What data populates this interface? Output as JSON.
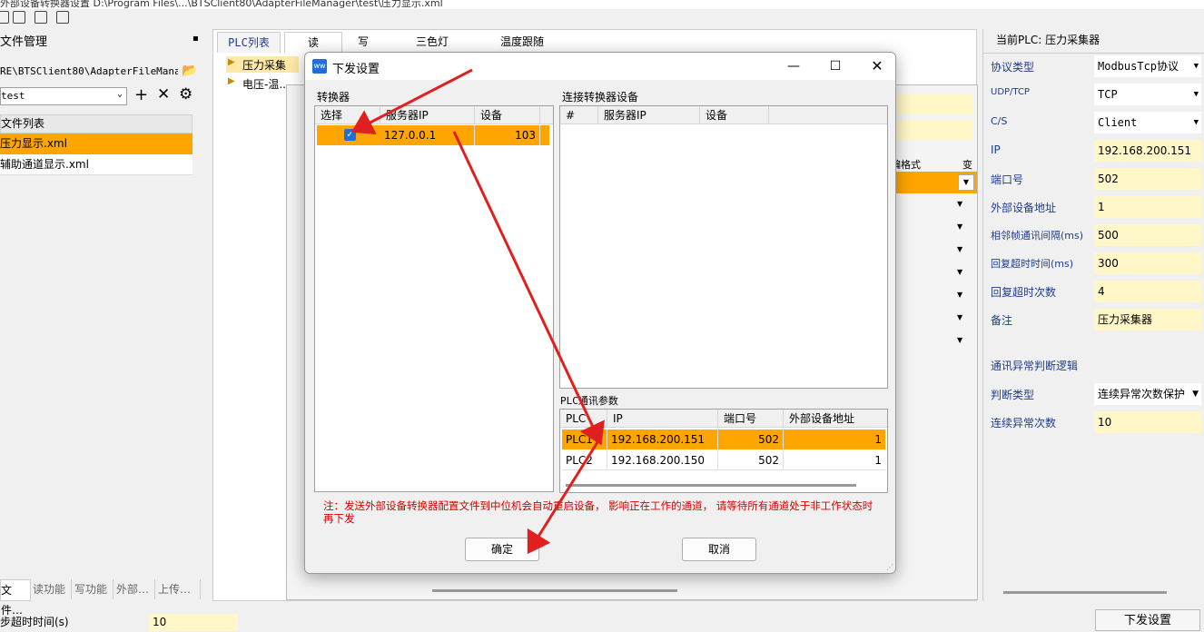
{
  "window": {
    "title_partial": "外部设备转换器设置 D:\\Program Files\\...\\BTSClient80\\AdapterFileManager\\test\\压力显示.xml"
  },
  "left": {
    "header": "文件管理",
    "path": "RE\\BTSClient80\\AdapterFileManager",
    "selected_folder": "test",
    "list_header": "文件列表",
    "files": [
      "压力显示.xml",
      "辅助通道显示.xml"
    ],
    "bottom_tabs": [
      "文件…",
      "读功能",
      "写功能",
      "外部…",
      "上传…"
    ]
  },
  "center": {
    "tabs": [
      "PLC列表",
      "读",
      "写",
      "三色灯",
      "温度跟随"
    ],
    "tree": [
      "压力采集",
      "电压-温..."
    ],
    "col_partial_1": "编格式",
    "col_partial_2": "变"
  },
  "right": {
    "header": "当前PLC:  压力采集器",
    "props": [
      {
        "label": "协议类型",
        "value": "ModbusTcp协议",
        "dropdown": true
      },
      {
        "label": "UDP/TCP",
        "value": "TCP",
        "dropdown": true
      },
      {
        "label": "C/S",
        "value": "Client",
        "dropdown": true
      },
      {
        "label": "IP",
        "value": "192.168.200.151"
      },
      {
        "label": "端口号",
        "value": "502"
      },
      {
        "label": "外部设备地址",
        "value": "1"
      },
      {
        "label": "相邻帧通讯间隔(ms)",
        "value": "500"
      },
      {
        "label": "回复超时时间(ms)",
        "value": "300"
      },
      {
        "label": "回复超时次数",
        "value": "4"
      },
      {
        "label": "备注",
        "value": "压力采集器"
      }
    ],
    "section2": "通讯异常判断逻辑",
    "props2": [
      {
        "label": "判断类型",
        "value": "连续异常次数保护",
        "dropdown": true
      },
      {
        "label": "连续异常次数",
        "value": "10"
      }
    ]
  },
  "footer": {
    "label": "步超时时间(s)",
    "value": "10",
    "send_button": "下发设置"
  },
  "dialog": {
    "title": "下发设置",
    "converter_label": "转换器",
    "converter_headers": [
      "选择",
      "服务器IP",
      "设备"
    ],
    "converter_rows": [
      {
        "checked": true,
        "ip": "127.0.0.1",
        "device": "103"
      }
    ],
    "connected_label": "连接转换器设备",
    "connected_headers": [
      "#",
      "服务器IP",
      "设备"
    ],
    "plc_label": "PLC通讯参数",
    "plc_headers": [
      "PLC",
      "IP",
      "端口号",
      "外部设备地址"
    ],
    "plc_rows": [
      {
        "name": "PLC1",
        "ip": "192.168.200.151",
        "port": "502",
        "addr": "1"
      },
      {
        "name": "PLC2",
        "ip": "192.168.200.150",
        "port": "502",
        "addr": "1"
      }
    ],
    "warning": "注：发送外部设备转换器配置文件到中位机会自动重启设备， 影响正在工作的通道， 请等待所有通道处于非工作状态时再下发",
    "ok": "确定",
    "cancel": "取消",
    "icon_text": "ww"
  },
  "colors": {
    "selection": "#ffa500",
    "highlight": "#fff7c8",
    "arrow": "#e02020",
    "check": "#1e6fd9"
  }
}
